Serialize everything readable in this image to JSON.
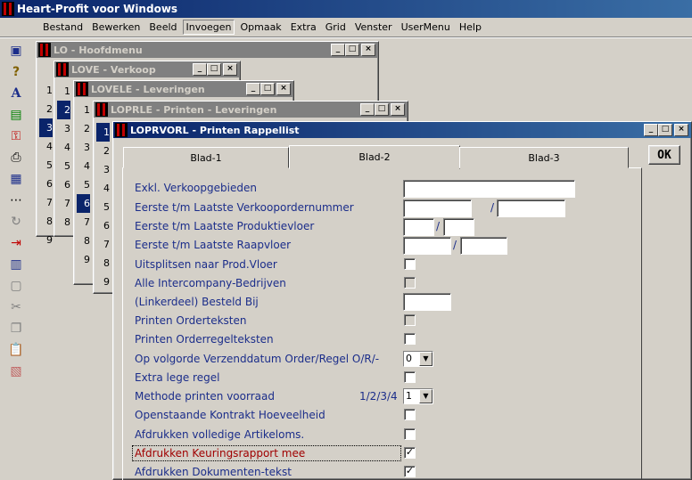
{
  "app_title": "Heart-Profit voor Windows",
  "menu": [
    "Bestand",
    "Bewerken",
    "Beeld",
    "Invoegen",
    "Opmaak",
    "Extra",
    "Grid",
    "Venster",
    "UserMenu",
    "Help"
  ],
  "menu_selected_index": 3,
  "windows": {
    "hoofdmenu": {
      "title": "LO - Hoofdmenu",
      "items": [
        "1",
        "2",
        "3",
        "4",
        "5",
        "6",
        "7",
        "8",
        "9"
      ]
    },
    "verkoop": {
      "title": "LOVE - Verkoop",
      "items": [
        "1",
        "2",
        "3",
        "4",
        "5",
        "6",
        "7",
        "8"
      ]
    },
    "leveringen": {
      "title": "LOVELE - Leveringen",
      "items": [
        "1",
        "2",
        "3",
        "4",
        "5",
        "6",
        "7",
        "8",
        "9"
      ]
    },
    "printen_lev": {
      "title": "LOPRLE - Printen - Leveringen",
      "items": [
        "1",
        "2",
        "3",
        "4",
        "5",
        "6",
        "7",
        "8",
        "9"
      ]
    },
    "rappellist": {
      "title": "LOPRVORL - Printen Rappellist"
    }
  },
  "tabs": [
    "Blad-1",
    "Blad-2",
    "Blad-3"
  ],
  "active_tab": 1,
  "ok_label": "OK",
  "form": {
    "excl_verkoopgebieden": "Exkl. Verkoopgebieden",
    "verkoopordernummer": "Eerste t/m Laatste Verkoopordernummer",
    "produktievloer": "Eerste t/m Laatste Produktievloer",
    "raapvloer": "Eerste t/m Laatste Raapvloer",
    "uitsplitsen": "Uitsplitsen naar Prod.Vloer",
    "intercompany": "Alle Intercompany-Bedrijven",
    "besteld_bij": "(Linkerdeel) Besteld Bij",
    "orderteksten": "Printen Orderteksten",
    "orderregelteksten": "Printen Orderregelteksten",
    "volgorde": "Op volgorde Verzenddatum Order/Regel O/R/-",
    "volgorde_value": "0",
    "extra_lege_regel": "Extra lege regel",
    "methode_voorraad": "Methode printen voorraad",
    "methode_hint": "1/2/3/4",
    "methode_value": "1",
    "kontrakt": "Openstaande Kontrakt Hoeveelheid",
    "artikeloms": "Afdrukken volledige Artikeloms.",
    "keuringsrapport": "Afdrukken Keuringsrapport mee",
    "dokumenten": "Afdrukken Dokumenten-tekst",
    "slash": "/"
  },
  "colors": {
    "active_title": "#0a246a",
    "label_blue": "#1b2d8a",
    "focus_red": "#a00000"
  }
}
